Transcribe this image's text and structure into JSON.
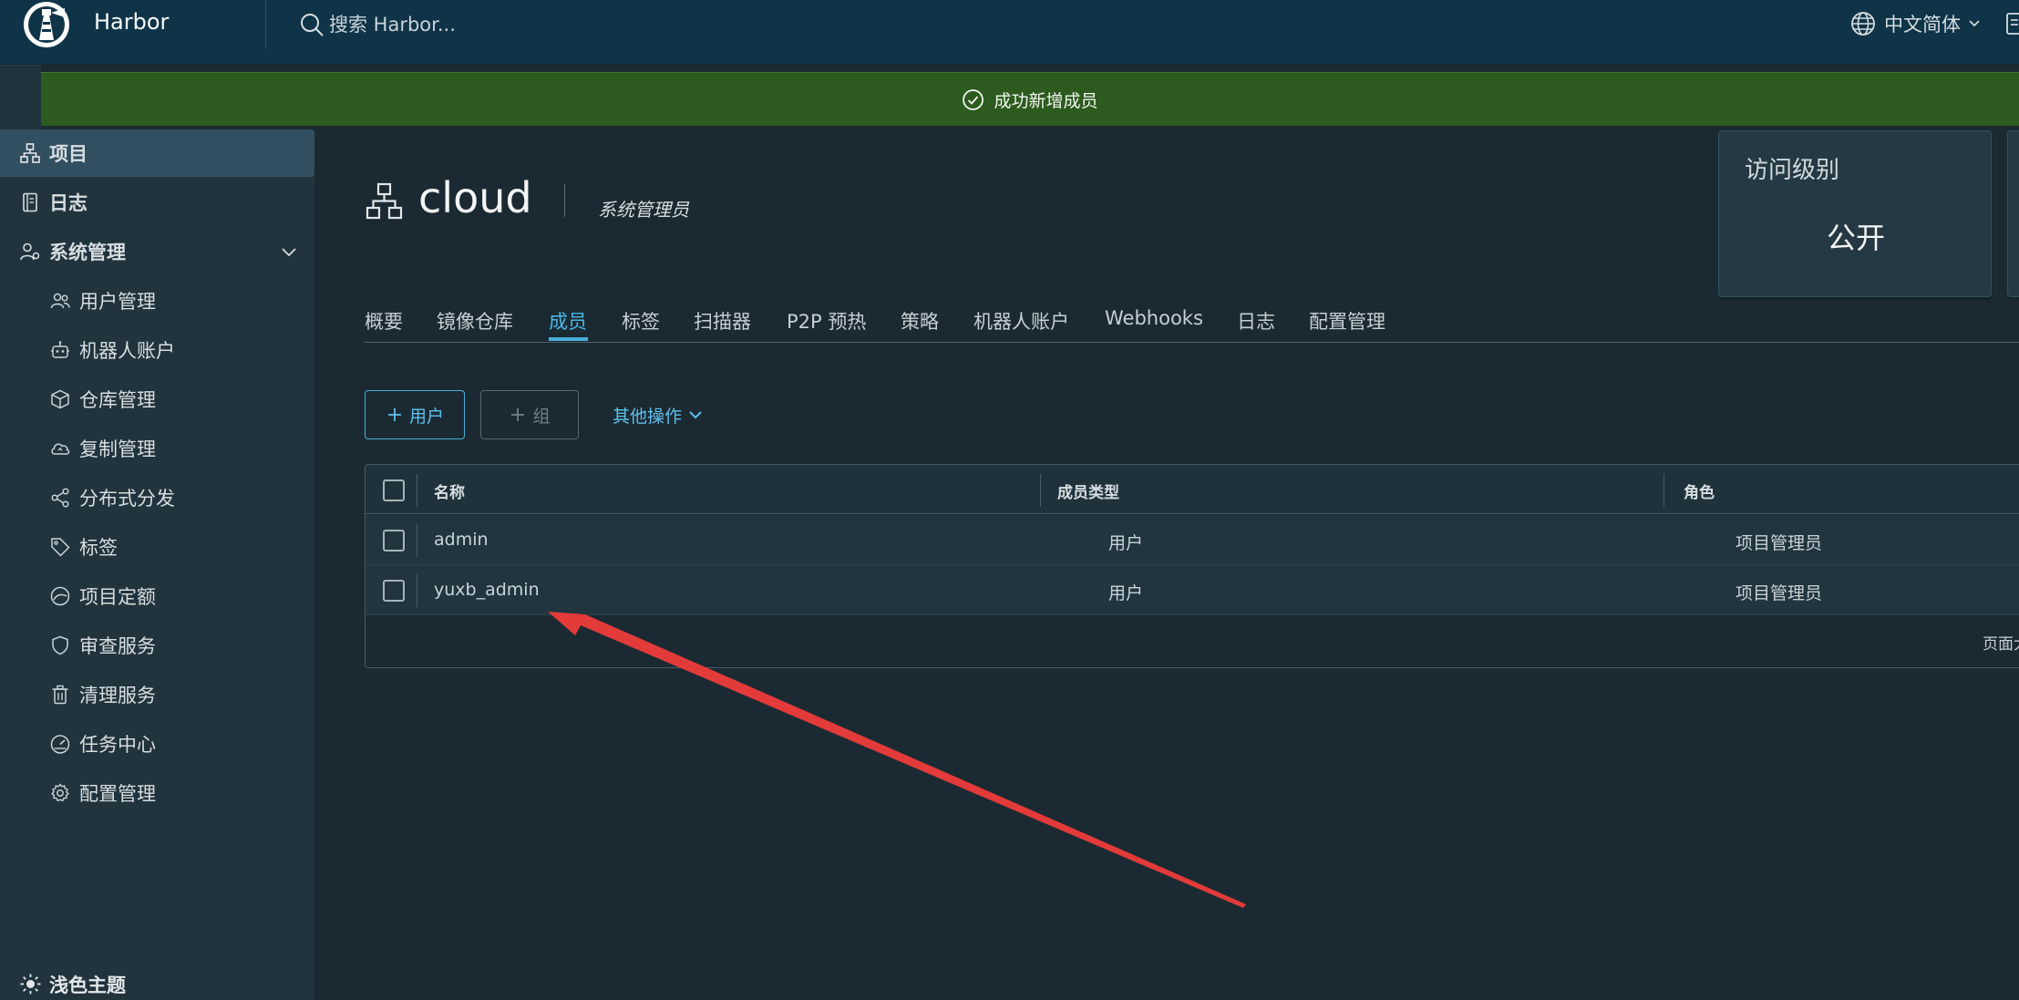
{
  "header": {
    "brand": "Harbor",
    "search_placeholder": "搜索 Harbor...",
    "language": "中文简体"
  },
  "notification": {
    "message": "成功新增成员"
  },
  "sidebar": {
    "items": [
      {
        "label": "项目",
        "icon": "projects-icon",
        "active": true
      },
      {
        "label": "日志",
        "icon": "log-icon"
      },
      {
        "label": "系统管理",
        "icon": "admin-icon",
        "expanded": true
      }
    ],
    "subitems": [
      {
        "label": "用户管理",
        "icon": "users-icon"
      },
      {
        "label": "机器人账户",
        "icon": "robot-icon"
      },
      {
        "label": "仓库管理",
        "icon": "registry-icon"
      },
      {
        "label": "复制管理",
        "icon": "replication-icon"
      },
      {
        "label": "分布式分发",
        "icon": "share-icon"
      },
      {
        "label": "标签",
        "icon": "tag-icon"
      },
      {
        "label": "项目定额",
        "icon": "quota-icon"
      },
      {
        "label": "审查服务",
        "icon": "shield-icon"
      },
      {
        "label": "清理服务",
        "icon": "trash-icon"
      },
      {
        "label": "任务中心",
        "icon": "dashboard-icon"
      },
      {
        "label": "配置管理",
        "icon": "gear-icon"
      }
    ],
    "theme_toggle": "浅色主题"
  },
  "project": {
    "name": "cloud",
    "role": "系统管理员",
    "access_level": {
      "title": "访问级别",
      "value": "公开"
    }
  },
  "tabs": [
    "概要",
    "镜像仓库",
    "成员",
    "标签",
    "扫描器",
    "P2P 预热",
    "策略",
    "机器人账户",
    "Webhooks",
    "日志",
    "配置管理"
  ],
  "active_tab": "成员",
  "toolbar": {
    "add_user": "用户",
    "add_group": "组",
    "more_actions": "其他操作"
  },
  "members_table": {
    "columns": [
      "名称",
      "成员类型",
      "角色"
    ],
    "rows": [
      {
        "name": "admin",
        "type": "用户",
        "role": "项目管理员"
      },
      {
        "name": "yuxb_admin",
        "type": "用户",
        "role": "项目管理员"
      }
    ],
    "footer": "页面大"
  },
  "colors": {
    "header_bg": "#0f3448",
    "sidebar_bg": "#21333c",
    "main_bg": "#1b2a32",
    "success_banner": "#2c5a1f",
    "accent": "#49afd9",
    "annotation_arrow": "#e33a3a"
  }
}
